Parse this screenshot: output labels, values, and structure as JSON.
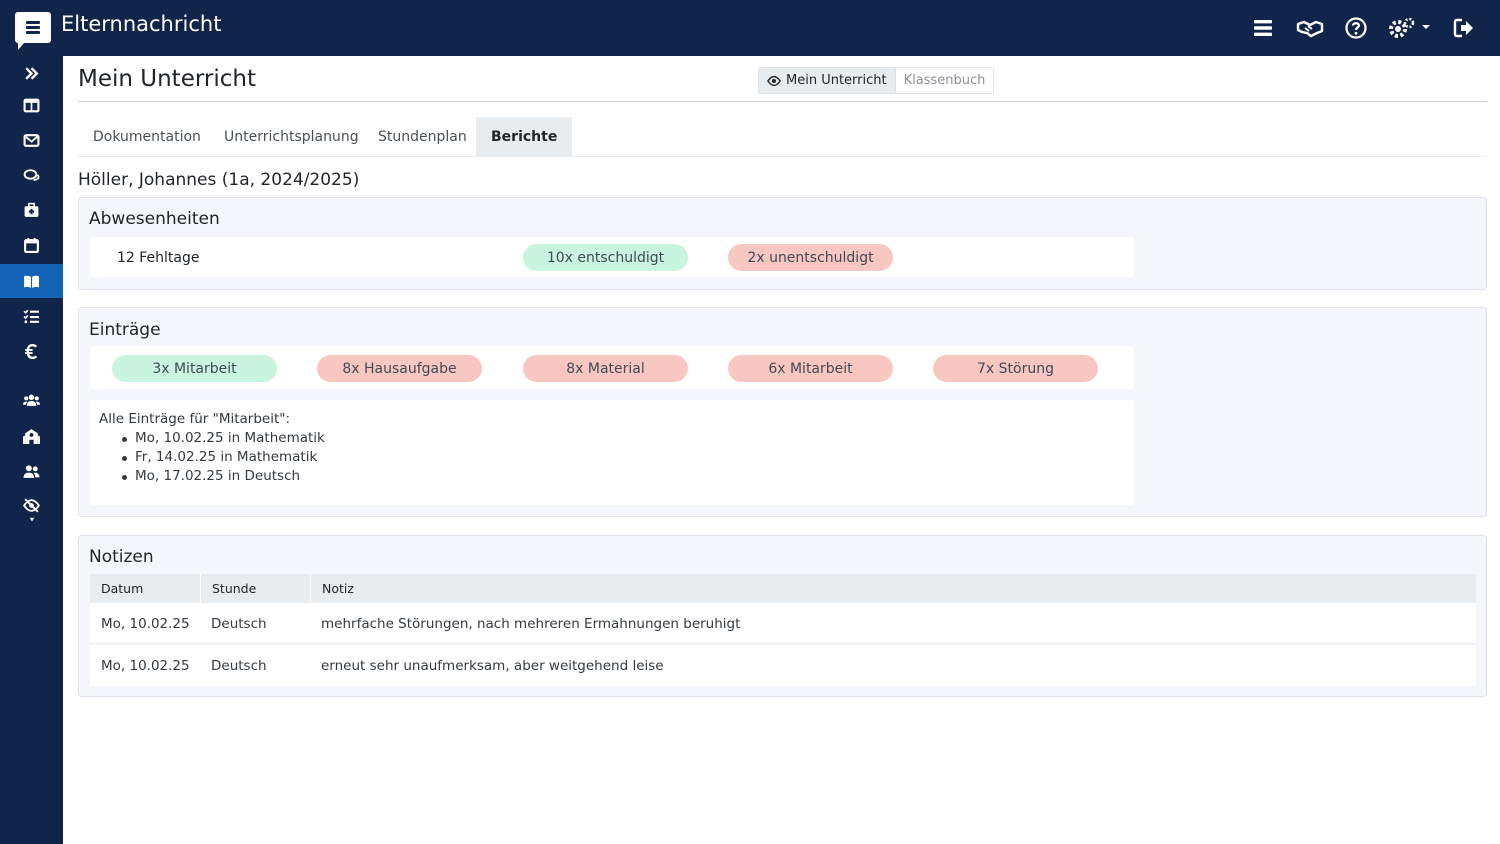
{
  "app": {
    "title": "Elternnachricht",
    "header_icons": [
      "menu-icon",
      "handshake-icon",
      "help-icon",
      "settings-icon",
      "logout-icon"
    ]
  },
  "sidebar": {
    "items": [
      {
        "icon": "expand-icon",
        "active": false
      },
      {
        "icon": "dashboard-icon",
        "active": false
      },
      {
        "icon": "mail-icon",
        "active": false
      },
      {
        "icon": "chat-icon",
        "active": false
      },
      {
        "icon": "first-aid-icon",
        "active": false
      },
      {
        "icon": "calendar-icon",
        "active": false
      },
      {
        "icon": "book-icon",
        "active": true
      },
      {
        "icon": "task-list-icon",
        "active": false
      },
      {
        "icon": "euro-icon",
        "active": false
      },
      {
        "icon": "users-icon",
        "active": false
      },
      {
        "icon": "school-icon",
        "active": false
      },
      {
        "icon": "user-group-icon",
        "active": false
      },
      {
        "icon": "eye-slash-icon",
        "active": false
      }
    ],
    "active_color": "#1463b6",
    "background_color": "#112449"
  },
  "page": {
    "title": "Mein Unterricht",
    "view_toggle": {
      "active": "Mein Unterricht",
      "inactive": "Klassenbuch"
    }
  },
  "tabs": [
    {
      "label": "Dokumentation",
      "active": false
    },
    {
      "label": "Unterrichtsplanung",
      "active": false
    },
    {
      "label": "Stundenplan",
      "active": false
    },
    {
      "label": "Berichte",
      "active": true
    }
  ],
  "student": {
    "heading": "Höller, Johannes (1a, 2024/2025)"
  },
  "absences": {
    "title": "Abwesenheiten",
    "total": "12 Fehltage",
    "excused": "10x entschuldigt",
    "unexcused": "2x unentschuldigt"
  },
  "entries": {
    "title": "Einträge",
    "badges": [
      {
        "label": "3x Mitarbeit",
        "status": "positive",
        "color": "#c9f5e0"
      },
      {
        "label": "8x Hausaufgabe",
        "status": "negative",
        "color": "#f9c7c2"
      },
      {
        "label": "8x Material",
        "status": "negative",
        "color": "#f9c7c2"
      },
      {
        "label": "6x Mitarbeit",
        "status": "negative",
        "color": "#f9c7c2"
      },
      {
        "label": "7x Störung",
        "status": "negative",
        "color": "#f9c7c2"
      }
    ],
    "detail_heading": "Alle Einträge für \"Mitarbeit\":",
    "detail_items": [
      "Mo, 10.02.25 in Mathematik",
      "Fr, 14.02.25 in Mathematik",
      "Mo, 17.02.25 in Deutsch"
    ]
  },
  "notes": {
    "title": "Notizen",
    "columns": [
      "Datum",
      "Stunde",
      "Notiz"
    ],
    "rows": [
      {
        "date": "Mo, 10.02.25",
        "lesson": "Deutsch",
        "note": "mehrfache Störungen, nach mehreren Ermahnungen beruhigt"
      },
      {
        "date": "Mo, 10.02.25",
        "lesson": "Deutsch",
        "note": "erneut sehr unaufmerksam, aber weitgehend leise"
      }
    ]
  }
}
